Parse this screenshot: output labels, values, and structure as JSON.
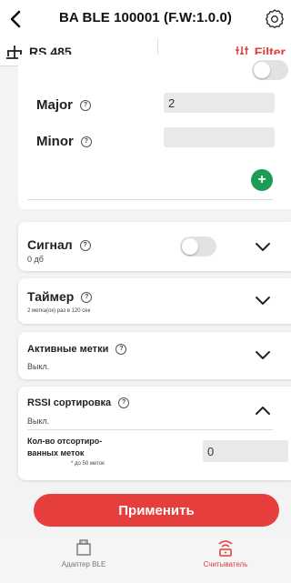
{
  "header": {
    "title": "BA BLE 100001 (F.W:1.0.0)"
  },
  "tabs": {
    "rs485": "RS 485",
    "filter": "Filter"
  },
  "fields": {
    "major_label": "Major",
    "major_value": "2",
    "minor_label": "Minor",
    "minor_value": "",
    "add_label": "+"
  },
  "help_glyph": "?",
  "accordions": [
    {
      "title": "Сигнал",
      "subtitle": "0 дб"
    },
    {
      "title": "Таймер",
      "subtitle": "2 метка(ок) раз в 120 сек"
    },
    {
      "title": "Активные метки",
      "subtitle": "Выкл."
    },
    {
      "title": "RSSI сортировка",
      "subtitle": "Выкл."
    }
  ],
  "rssi": {
    "count_label_line1": "Кол-во отсортиро-",
    "count_label_line2": "ванных меток",
    "count_hint": "* до 50 меток",
    "count_value": "0"
  },
  "apply_label": "Применить",
  "nav": {
    "adapter": "Адаптер BLE",
    "reader": "Считыватель"
  },
  "colors": {
    "accent": "#e63d3d",
    "add": "#1f9d55"
  },
  "icons": [
    "back-arrow-icon",
    "gear-icon",
    "network-icon",
    "filter-icon",
    "help-icon",
    "chevron-down-icon",
    "chevron-up-icon",
    "adapter-icon",
    "reader-icon"
  ]
}
